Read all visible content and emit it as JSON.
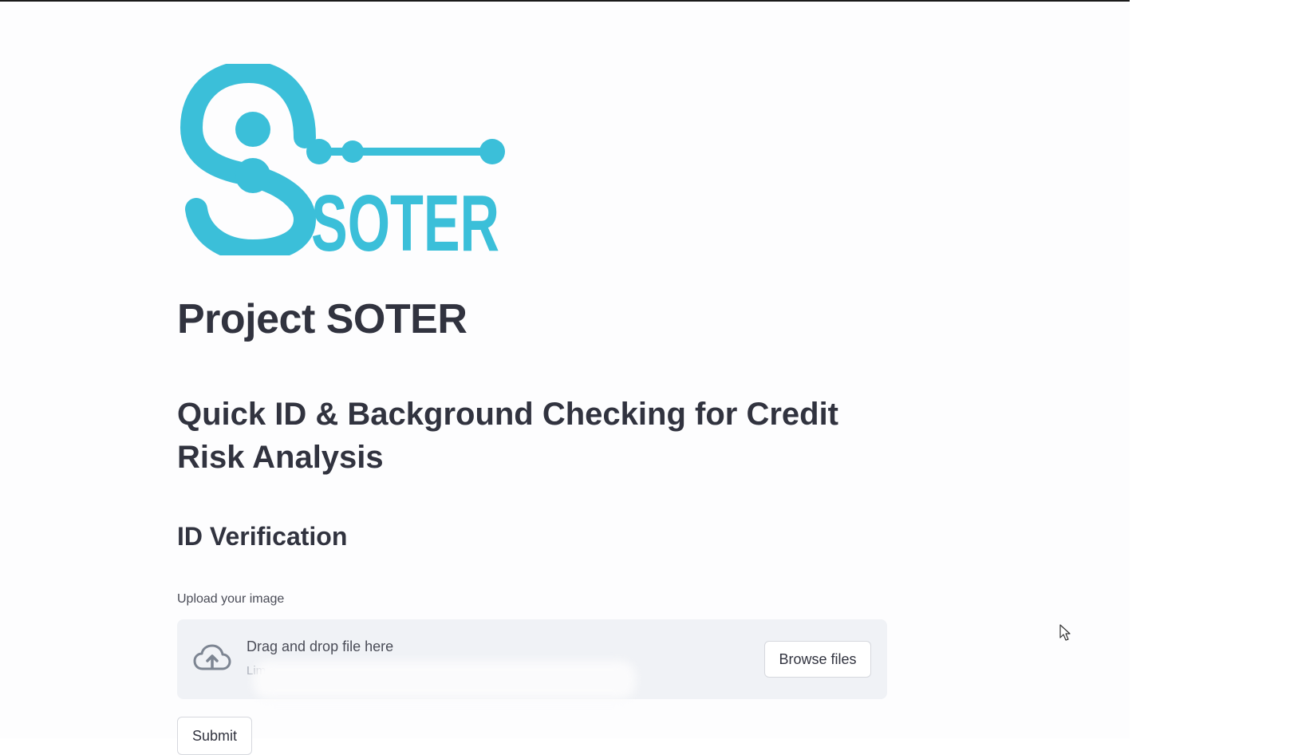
{
  "brand": {
    "logo_text": "SOTER",
    "logo_color": "#3bbfd9"
  },
  "page": {
    "title": "Project SOTER",
    "subtitle": "Quick ID & Background Checking for Credit Risk Analysis"
  },
  "id_verification": {
    "heading": "ID Verification",
    "upload_label": "Upload your image",
    "dropzone": {
      "title": "Drag and drop file here",
      "limit_text": "Lim",
      "icon": "cloud-upload-icon"
    },
    "browse_label": "Browse files",
    "submit_label": "Submit"
  },
  "colors": {
    "text": "#31333f",
    "dropzone_bg": "#f0f2f6",
    "accent": "#3bbfd9"
  }
}
